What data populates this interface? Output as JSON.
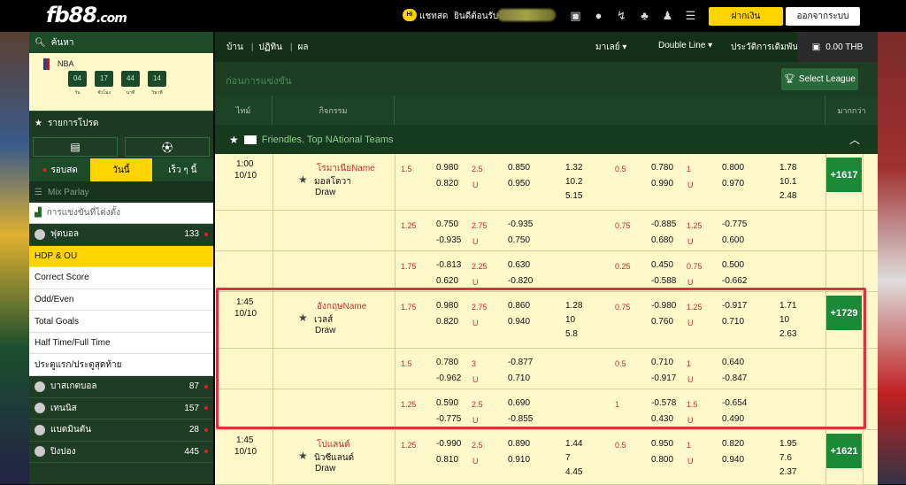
{
  "header": {
    "logo": "fb88",
    "logo_suffix": ".com",
    "chat_badge": "Hi",
    "chat_label": "แชทสด",
    "welcome": "ยินดีต้อนรับ",
    "deposit": "ฝากเงิน",
    "logout": "ออกจากระบบ",
    "icons": [
      "wallet-icon",
      "coin-icon",
      "transfer-icon",
      "casino-icon",
      "user-icon",
      "list-icon"
    ]
  },
  "sidebar": {
    "search": "ค้นหา",
    "nba": "NBA",
    "timer_labels": [
      "วัน",
      "ชั่วโมง",
      "นาที",
      "วินาที"
    ],
    "timer_values": [
      "04",
      "17",
      "44",
      "14"
    ],
    "favorites": "รายการโปรด",
    "tabs": [
      "รอบสด",
      "วันนี้",
      "เร็ว ๆ นี้"
    ],
    "mix_parlay": "Mix Parlay",
    "outright": "การแข่งขันที่ไต่งตั้ง",
    "football": {
      "label": "ฟุตบอล",
      "count": "133"
    },
    "sub": [
      "HDP & OU",
      "Correct Score",
      "Odd/Even",
      "Total Goals",
      "Half Time/Full Time",
      "ประตูแรก/ประตูสุดท้าย"
    ],
    "sports": [
      {
        "label": "บาสเกตบอล",
        "count": "87"
      },
      {
        "label": "เทนนิส",
        "count": "157"
      },
      {
        "label": "แบดมินตัน",
        "count": "28"
      },
      {
        "label": "ปิงปอง",
        "count": "445"
      }
    ]
  },
  "nav": {
    "home": "บ้าน",
    "calendar": "ปฏิทิน",
    "results": "ผล",
    "malay": "มาเลย์",
    "double_line": "Double Line",
    "history": "ประวัติการเดิมพัน",
    "balance": "0.00 THB"
  },
  "section": {
    "title": "ก่อนการแข่งขัน",
    "select_league": "Select League"
  },
  "columns": {
    "time": "ไทม์",
    "event": "กิจกรรม",
    "more": "มากกว่า"
  },
  "league": "Friendles. Top NAtional Teams",
  "matches": [
    {
      "time": "1:00",
      "date": "10/10",
      "home": "โรมาเนียName",
      "away": "มอลโดวา",
      "draw": "Draw",
      "more": "+1617",
      "lines": [
        {
          "h1": "1.5",
          "o1": [
            "0.980",
            "0.820"
          ],
          "g1": [
            "2.5",
            "U"
          ],
          "o2": [
            "0.850",
            "0.950"
          ],
          "x1": [
            "1.32",
            "10.2",
            "5.15"
          ],
          "h2": "0.5",
          "o3": [
            "0.780",
            "0.990"
          ],
          "g2": [
            "1",
            "U"
          ],
          "o4": [
            "0.800",
            "0.970"
          ],
          "x2": [
            "1.78",
            "10.1",
            "2.48"
          ]
        },
        {
          "h1": "1.25",
          "o1": [
            "0.750",
            "-0.935"
          ],
          "g1": [
            "2.75",
            "U"
          ],
          "o2": [
            "-0.935",
            "0.750"
          ],
          "x1": [],
          "h2": "0.75",
          "o3": [
            "-0.885",
            "0.680"
          ],
          "g2": [
            "1.25",
            "U"
          ],
          "o4": [
            "-0.775",
            "0.600"
          ],
          "x2": []
        },
        {
          "h1": "1.75",
          "o1": [
            "-0.813",
            "0.620"
          ],
          "g1": [
            "2.25",
            "U"
          ],
          "o2": [
            "0.630",
            "-0.820"
          ],
          "x1": [],
          "h2": "0.25",
          "o3": [
            "0.450",
            "-0.588"
          ],
          "g2": [
            "0.75",
            "U"
          ],
          "o4": [
            "0.500",
            "-0.662"
          ],
          "x2": []
        }
      ]
    },
    {
      "time": "1:45",
      "date": "10/10",
      "home": "อังกฤษName",
      "away": "เวลส์",
      "draw": "Draw",
      "more": "+1729",
      "lines": [
        {
          "h1": "1.75",
          "o1": [
            "0.980",
            "0.820"
          ],
          "g1": [
            "2.75",
            "U"
          ],
          "o2": [
            "0.860",
            "0.940"
          ],
          "x1": [
            "1.28",
            "10",
            "5.8"
          ],
          "h2": "0.75",
          "o3": [
            "-0.980",
            "0.760"
          ],
          "g2": [
            "1.25",
            "U"
          ],
          "o4": [
            "-0.917",
            "0.710"
          ],
          "x2": [
            "1.71",
            "10",
            "2.63"
          ]
        },
        {
          "h1": "1.5",
          "o1": [
            "0.780",
            "-0.962"
          ],
          "g1": [
            "3",
            "U"
          ],
          "o2": [
            "-0.877",
            "0.710"
          ],
          "x1": [],
          "h2": "0.5",
          "o3": [
            "0.710",
            "-0.917"
          ],
          "g2": [
            "1",
            "U"
          ],
          "o4": [
            "0.640",
            "-0.847"
          ],
          "x2": []
        },
        {
          "h1": "1.25",
          "o1": [
            "0.590",
            "-0.775"
          ],
          "g1": [
            "2.5",
            "U"
          ],
          "o2": [
            "0.690",
            "-0.855"
          ],
          "x1": [],
          "h2": "1",
          "o3": [
            "-0.578",
            "0.430"
          ],
          "g2": [
            "1.5",
            "U"
          ],
          "o4": [
            "-0.654",
            "0.490"
          ],
          "x2": []
        }
      ]
    },
    {
      "time": "1:45",
      "date": "10/10",
      "home": "โปแลนด์",
      "away": "นิวซีแลนด์",
      "draw": "Draw",
      "more": "+1621",
      "lines": [
        {
          "h1": "1.25",
          "o1": [
            "-0.990",
            "0.810"
          ],
          "g1": [
            "2.5",
            "U"
          ],
          "o2": [
            "0.890",
            "0.910"
          ],
          "x1": [
            "1.44",
            "7",
            "4.45"
          ],
          "h2": "0.5",
          "o3": [
            "0.950",
            "0.800"
          ],
          "g2": [
            "1",
            "U"
          ],
          "o4": [
            "0.820",
            "0.940"
          ],
          "x2": [
            "1.95",
            "7.6",
            "2.37"
          ]
        }
      ]
    }
  ]
}
